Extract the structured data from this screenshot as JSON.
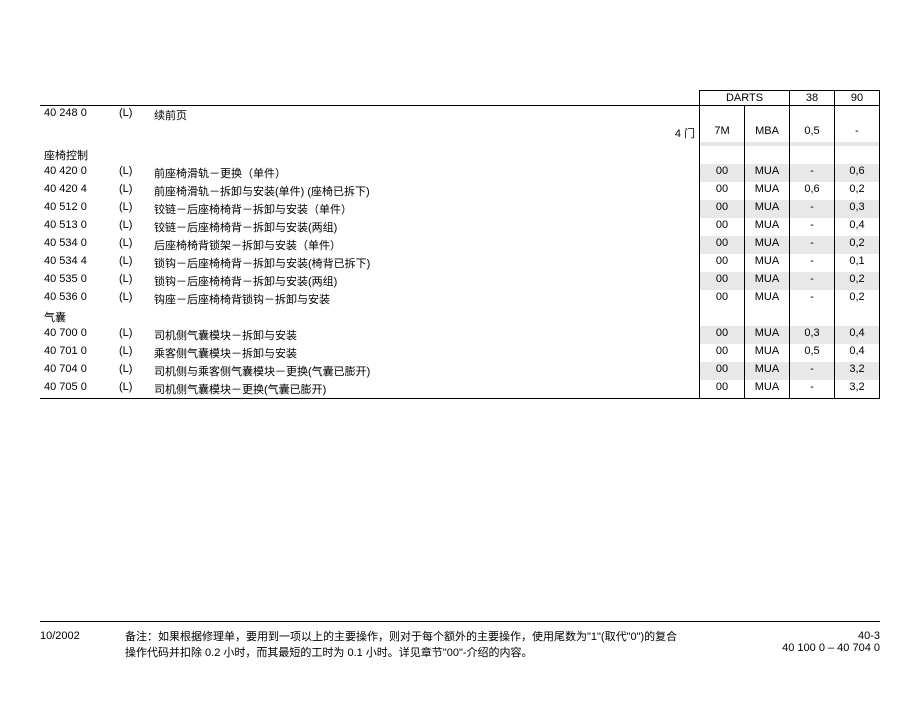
{
  "header": {
    "darts": "DARTS",
    "col38": "38",
    "col90": "90"
  },
  "topRow": {
    "code": "40 248 0",
    "l": "(L)",
    "desc": "续前页"
  },
  "subRow": {
    "right_label": "4 门",
    "d1": "7M",
    "d2": "MBA",
    "c38": "0,5",
    "c90": "-"
  },
  "sections": [
    {
      "title": "座椅控制",
      "rows": [
        {
          "code": "40 420 0",
          "l": "(L)",
          "desc": "前座椅滑轨－更换（单件）",
          "d1": "00",
          "d2": "MUA",
          "c38": "-",
          "c90": "0,6",
          "bold": true,
          "stripe": true
        },
        {
          "code": "40 420 4",
          "l": "(L)",
          "desc": "前座椅滑轨－拆卸与安装(单件) (座椅已拆下)",
          "d1": "00",
          "d2": "MUA",
          "c38": "0,6",
          "c90": "0,2",
          "bold": false,
          "stripe": false
        },
        {
          "code": "40 512 0",
          "l": "(L)",
          "desc": "铰链－后座椅椅背－拆卸与安装（单件）",
          "d1": "00",
          "d2": "MUA",
          "c38": "-",
          "c90": "0,3",
          "bold": true,
          "stripe": true
        },
        {
          "code": "40 513 0",
          "l": "(L)",
          "desc": "铰链－后座椅椅背－拆卸与安装(两组)",
          "d1": "00",
          "d2": "MUA",
          "c38": "-",
          "c90": "0,4",
          "bold": true,
          "stripe": false
        },
        {
          "code": "40 534 0",
          "l": "(L)",
          "desc": "后座椅椅背锁架－拆卸与安装（单件）",
          "d1": "00",
          "d2": "MUA",
          "c38": "-",
          "c90": "0,2",
          "bold": true,
          "stripe": true
        },
        {
          "code": "40 534 4",
          "l": "(L)",
          "desc": "锁钩－后座椅椅背－拆卸与安装(椅背已拆下)",
          "d1": "00",
          "d2": "MUA",
          "c38": "-",
          "c90": "0,1",
          "bold": false,
          "stripe": false
        },
        {
          "code": "40 535 0",
          "l": "(L)",
          "desc": "锁钩－后座椅椅背－拆卸与安装(两组)",
          "d1": "00",
          "d2": "MUA",
          "c38": "-",
          "c90": "0,2",
          "bold": true,
          "stripe": true
        },
        {
          "code": "40 536 0",
          "l": "(L)",
          "desc": "钩座－后座椅椅背锁钩－拆卸与安装",
          "d1": "00",
          "d2": "MUA",
          "c38": "-",
          "c90": "0,2",
          "bold": true,
          "stripe": false
        }
      ]
    },
    {
      "title": "气囊",
      "rows": [
        {
          "code": "40 700 0",
          "l": "(L)",
          "desc": "司机侧气囊模块－拆卸与安装",
          "d1": "00",
          "d2": "MUA",
          "c38": "0,3",
          "c90": "0,4",
          "bold": true,
          "stripe": true
        },
        {
          "code": "40 701 0",
          "l": "(L)",
          "desc": "乘客侧气囊模块－拆卸与安装",
          "d1": "00",
          "d2": "MUA",
          "c38": "0,5",
          "c90": "0,4",
          "bold": true,
          "stripe": false
        },
        {
          "code": "40 704 0",
          "l": "(L)",
          "desc": "司机侧与乘客侧气囊模块－更换(气囊已膨开)",
          "d1": "00",
          "d2": "MUA",
          "c38": "-",
          "c90": "3,2",
          "bold": true,
          "stripe": true
        },
        {
          "code": "40 705 0",
          "l": "(L)",
          "desc": "司机侧气囊模块－更换(气囊已膨开)",
          "d1": "00",
          "d2": "MUA",
          "c38": "-",
          "c90": "3,2",
          "bold": true,
          "stripe": false
        }
      ]
    }
  ],
  "footer": {
    "date": "10/2002",
    "note_prefix": "备注：",
    "note_line1": "如果根据修理单，要用到一项以上的主要操作，则对于每个额外的主要操作，使用尾数为\"1\"(取代\"0\")的复合",
    "note_line2": "操作代码并扣除 0.2 小时，而其最短的工时为 0.1 小时。详见章节\"00\"-介绍的内容。",
    "page_no": "40-3",
    "range": "40 100 0 – 40 704 0"
  }
}
